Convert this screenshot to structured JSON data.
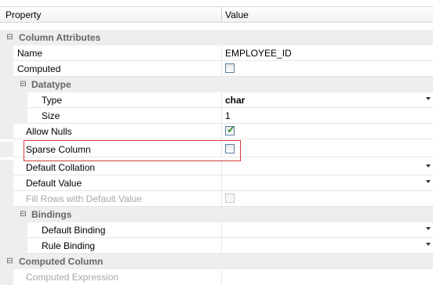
{
  "header": {
    "property": "Property",
    "value": "Value"
  },
  "rows": {
    "column_attributes": {
      "label": "Column Attributes"
    },
    "name": {
      "label": "Name",
      "value": "EMPLOYEE_ID"
    },
    "computed": {
      "label": "Computed"
    },
    "datatype": {
      "label": "Datatype"
    },
    "type": {
      "label": "Type",
      "value": "char"
    },
    "size": {
      "label": "Size",
      "value": "1"
    },
    "allow_nulls": {
      "label": "Allow Nulls",
      "checked": true
    },
    "sparse_column": {
      "label": "Sparse Column",
      "checked": false
    },
    "default_collation": {
      "label": "Default Collation"
    },
    "default_value": {
      "label": "Default Value"
    },
    "fill_rows": {
      "label": "Fill Rows with Default Value"
    },
    "bindings": {
      "label": "Bindings"
    },
    "default_binding": {
      "label": "Default Binding"
    },
    "rule_binding": {
      "label": "Rule Binding"
    },
    "computed_column": {
      "label": "Computed Column"
    },
    "computed_expression": {
      "label": "Computed Expression"
    }
  },
  "colors": {
    "highlight_border": "#d33a3a",
    "check": "#2f8f1f",
    "category_bg": "#eeeeee"
  },
  "icons": {
    "collapse": "minus-box-icon",
    "dropdown": "dropdown-arrow-icon",
    "check": "checkmark-icon"
  }
}
